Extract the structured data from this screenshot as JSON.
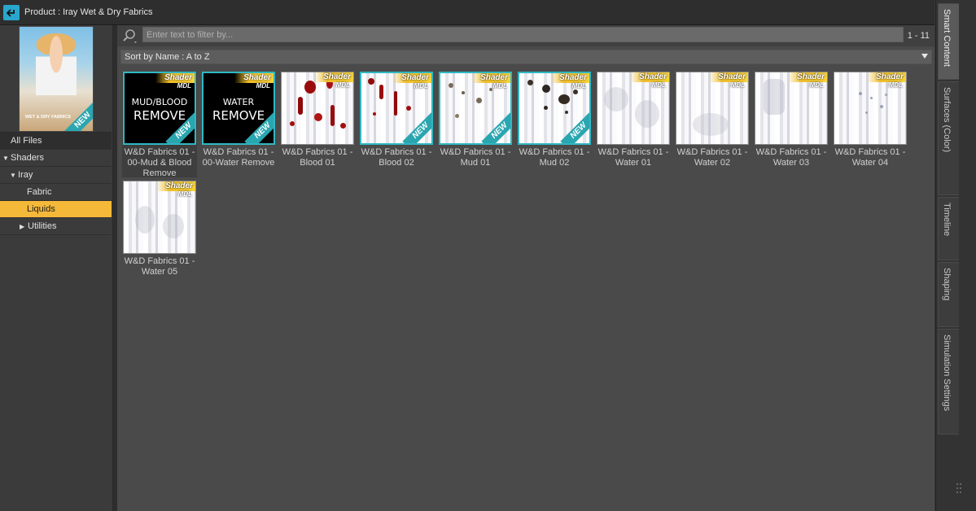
{
  "header": {
    "title": "Product :  Iray Wet & Dry Fabrics",
    "back_icon": "back-arrow-icon"
  },
  "product_thumb": {
    "logo_text": "WET & DRY FABRICS",
    "badge": "NEW"
  },
  "tree": {
    "all_files": "All Files",
    "items": [
      {
        "label": "Shaders",
        "expanded": true,
        "level": 0
      },
      {
        "label": "Iray",
        "expanded": true,
        "level": 1
      },
      {
        "label": "Fabric",
        "level": 2
      },
      {
        "label": "Liquids",
        "level": 2,
        "selected": true
      },
      {
        "label": "Utilities",
        "expanded": false,
        "level": 2
      }
    ]
  },
  "filter": {
    "placeholder": "Enter text to filter by...",
    "value": "",
    "count": "1 - 11",
    "icon": "search-icon"
  },
  "sort": {
    "label": "Sort by Name : A to Z"
  },
  "badges": {
    "shader": "Shader",
    "mdl": "MDL",
    "new": "NEW"
  },
  "tiles": [
    {
      "label": "W&D Fabrics 01 - 00-Mud & Blood Remove",
      "thumb_line1": "MUD/BLOOD",
      "thumb_line2": "REMOVE",
      "style": "black",
      "new": true
    },
    {
      "label": "W&D Fabrics 01 - 00-Water Remove",
      "thumb_line1": "WATER",
      "thumb_line2": "REMOVE",
      "style": "black",
      "new": true
    },
    {
      "label": "W&D Fabrics 01 - Blood 01",
      "style": "blood",
      "new": false
    },
    {
      "label": "W&D Fabrics 01 - Blood 02",
      "style": "blood",
      "new": true
    },
    {
      "label": "W&D Fabrics 01 - Mud 01",
      "style": "mud",
      "new": true
    },
    {
      "label": "W&D Fabrics 01 - Mud 02",
      "style": "mud",
      "new": true
    },
    {
      "label": "W&D Fabrics 01 - Water 01",
      "style": "water",
      "new": false
    },
    {
      "label": "W&D Fabrics 01 - Water 02",
      "style": "water",
      "new": false
    },
    {
      "label": "W&D Fabrics 01 - Water 03",
      "style": "water",
      "new": false
    },
    {
      "label": "W&D Fabrics 01 - Water 04",
      "style": "water",
      "new": false
    },
    {
      "label": "W&D Fabrics 01 - Water 05",
      "style": "water",
      "new": false
    }
  ],
  "right_tabs": [
    {
      "label": "Smart Content",
      "active": true
    },
    {
      "label": "Surfaces (Color)"
    },
    {
      "label": "Timeline"
    },
    {
      "label": "Shaping"
    },
    {
      "label": "Simulation Settings"
    }
  ],
  "colors": {
    "accent_blue": "#29a6cc",
    "selection_yellow": "#f5b93a",
    "teal": "#31b7c2"
  }
}
